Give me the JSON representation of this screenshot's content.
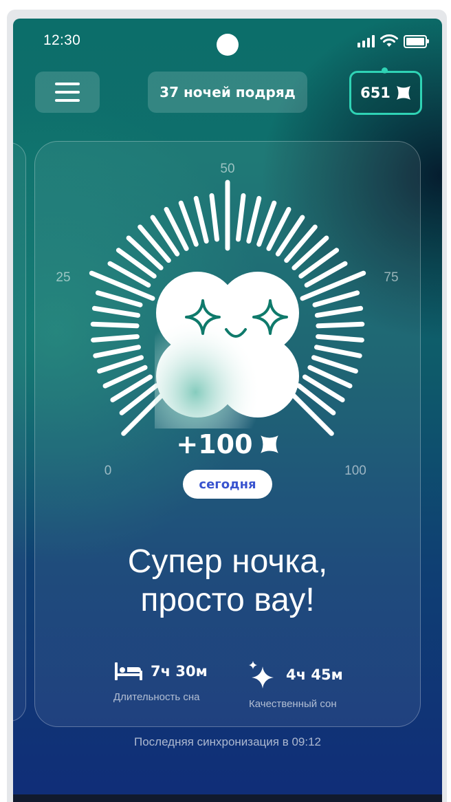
{
  "status_bar": {
    "time": "12:30"
  },
  "header": {
    "streak_text": "37 ночей подряд",
    "points_value": "651"
  },
  "gauge": {
    "scale_labels": [
      "0",
      "25",
      "50",
      "75",
      "100"
    ]
  },
  "reward": {
    "amount": "+100",
    "period_badge": "сегодня"
  },
  "headline": {
    "line1": "Супер ночка,",
    "line2": "просто вау!"
  },
  "stats": {
    "duration": {
      "value": "7ч 30м",
      "label": "Длительность сна",
      "icon": "bed-icon"
    },
    "quality": {
      "value": "4ч 45м",
      "label": "Качественный сон",
      "icon": "sparkle-icon"
    }
  },
  "sync": {
    "text": "Последняя синхронизация в 09:12"
  },
  "colors": {
    "accent_teal": "#2fd3b5",
    "badge_text": "#3853cf",
    "mascot_outline": "#0f7a6b"
  }
}
